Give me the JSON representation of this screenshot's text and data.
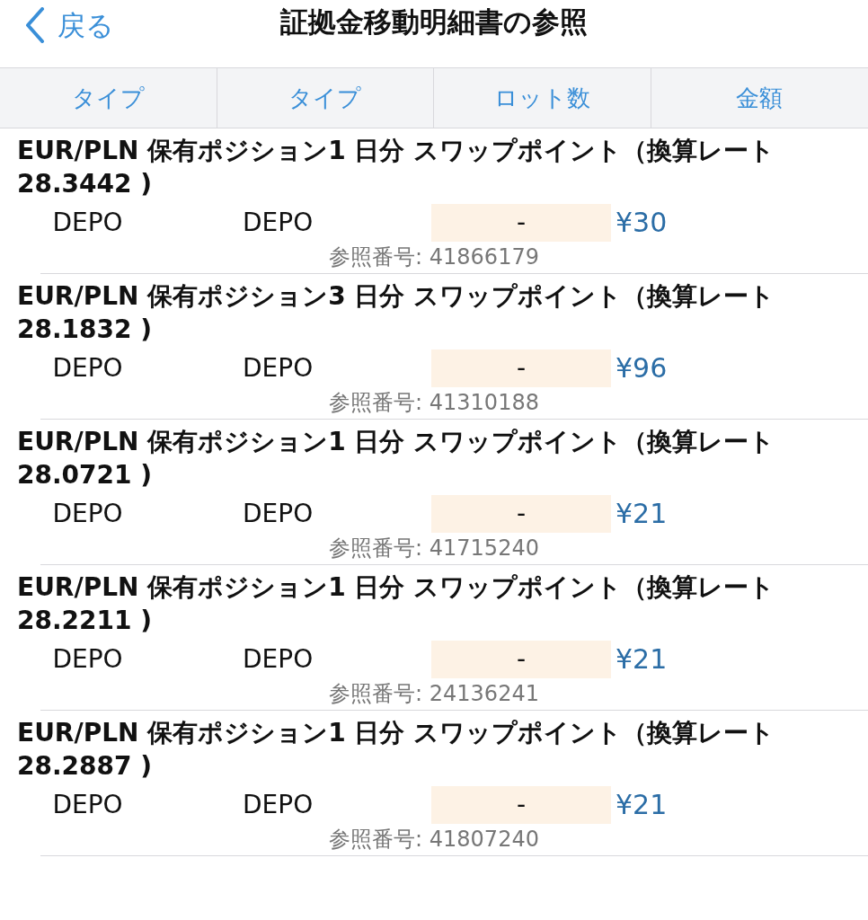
{
  "nav": {
    "back": "戻る",
    "title": "証拠金移動明細書の参照"
  },
  "columns": [
    "タイプ",
    "タイプ",
    "ロット数",
    "金額"
  ],
  "entries": [
    {
      "title": "EUR/PLN 保有ポジション1 日分 スワップポイント（換算レート 28.3442 )",
      "type_1": "DEPO",
      "type_2": "DEPO",
      "lots": "-",
      "amount": "¥30",
      "reference": "参照番号: 41866179"
    },
    {
      "title": "EUR/PLN 保有ポジション3 日分 スワップポイント（換算レート 28.1832 )",
      "type_1": "DEPO",
      "type_2": "DEPO",
      "lots": "-",
      "amount": "¥96",
      "reference": "参照番号: 41310188"
    },
    {
      "title": "EUR/PLN 保有ポジション1 日分 スワップポイント（換算レート 28.0721 )",
      "type_1": "DEPO",
      "type_2": "DEPO",
      "lots": "-",
      "amount": "¥21",
      "reference": "参照番号: 41715240"
    },
    {
      "title": "EUR/PLN 保有ポジション1 日分 スワップポイント（換算レート 28.2211 )",
      "type_1": "DEPO",
      "type_2": "DEPO",
      "lots": "-",
      "amount": "¥21",
      "reference": "参照番号: 24136241"
    },
    {
      "title": "EUR/PLN 保有ポジション1 日分 スワップポイント（換算レート 28.2887 )",
      "type_1": "DEPO",
      "type_2": "DEPO",
      "lots": "-",
      "amount": "¥21",
      "reference": "参照番号: 41807240"
    }
  ]
}
